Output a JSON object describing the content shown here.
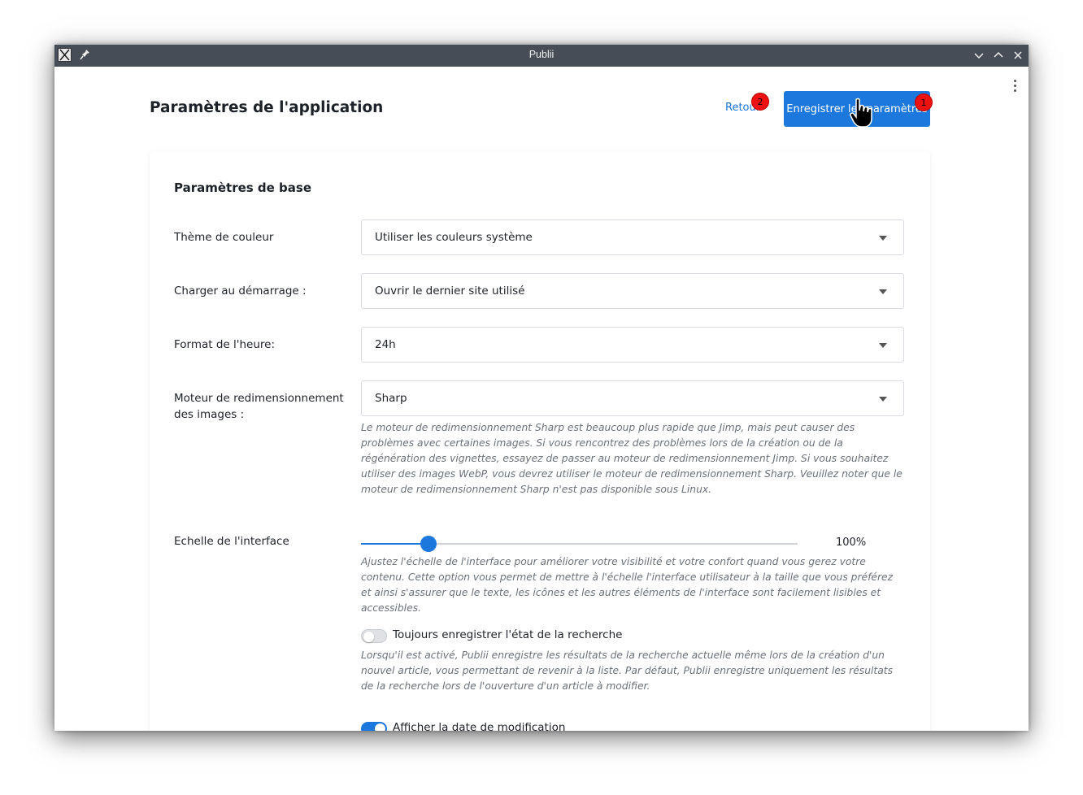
{
  "window": {
    "title": "Publii"
  },
  "header": {
    "title": "Paramètres de l'application",
    "back_label": "Retour",
    "save_label": "Enregistrer les paramètres"
  },
  "badges": {
    "save": "1",
    "back": "2"
  },
  "section": {
    "title": "Paramètres de base"
  },
  "settings": {
    "theme": {
      "label": "Thème de couleur",
      "value": "Utiliser les couleurs système"
    },
    "startup": {
      "label": "Charger au démarrage :",
      "value": "Ouvrir le dernier site utilisé"
    },
    "time_format": {
      "label": "Format de l'heure:",
      "value": "24h"
    },
    "resize_engine": {
      "label": "Moteur de redimensionnement des images :",
      "value": "Sharp",
      "help": "Le moteur de redimensionnement Sharp est beaucoup plus rapide que Jimp, mais peut causer des problèmes avec certaines images. Si vous rencontrez des problèmes lors de la création ou de la régénération des vignettes, essayez de passer au moteur de redimensionnement Jimp. Si vous souhaitez utiliser des images WebP, vous devrez utiliser le moteur de redimensionnement Sharp. Veuillez noter que le moteur de redimensionnement Sharp n'est pas disponible sous Linux."
    },
    "ui_scale": {
      "label": "Echelle de l'interface",
      "value_text": "100%",
      "slider_fraction": 0.155,
      "help": "Ajustez l'échelle de l'interface pour améliorer votre visibilité et votre confort quand vous gerez votre contenu. Cette option vous permet de mettre à l'échelle l'interface utilisateur à la taille que vous préférez et ainsi s'assurer que le texte, les icônes et les autres éléments de l'interface sont facilement lisibles et accessibles."
    },
    "save_search_state": {
      "label": "Toujours enregistrer l'état de la recherche",
      "enabled": false,
      "help": "Lorsqu'il est activé, Publii enregistre les résultats de la recherche actuelle même lors de la création d'un nouvel article, vous permettant de revenir à la liste. Par défaut, Publii enregistre uniquement les résultats de la recherche lors de l'ouverture d'un article à modifier."
    },
    "show_modified_date": {
      "label": "Afficher la date de modification",
      "enabled": true
    }
  },
  "colors": {
    "accent": "#1c78dc",
    "titlebar": "#474d56",
    "badge": "#ee1111"
  }
}
